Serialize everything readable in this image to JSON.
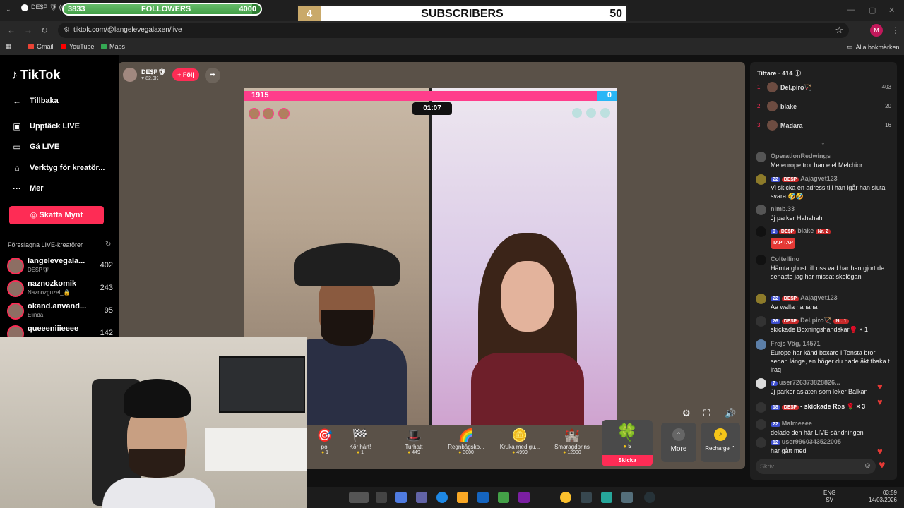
{
  "browser": {
    "tab_title": "DE$P 🛡 (@l",
    "url": "tiktok.com/@langelevegalaxen/live",
    "profile_initial": "M",
    "bookmarks": [
      "Gmail",
      "YouTube",
      "Maps"
    ],
    "all_bookmarks": "Alla bokmärken"
  },
  "overlay": {
    "followers_label": "FOLLOWERS",
    "followers_current": "3833",
    "followers_goal": "4000",
    "followers_progress": 0.958,
    "subs_number": "4",
    "subs_label": "SUBSCRIBERS",
    "subs_count": "50"
  },
  "sidebar": {
    "logo": "TikTok",
    "back": "Tillbaka",
    "nav": [
      "Upptäck LIVE",
      "Gå LIVE",
      "Verktyg för kreatör...",
      "Mer"
    ],
    "coins_button": "Skaffa Mynt",
    "suggested_title": "Föreslagna LIVE-kreatörer",
    "creators": [
      {
        "name": "langelevegala...",
        "sub": "DE$P🛡",
        "count": "402"
      },
      {
        "name": "naznozkomik",
        "sub": "Naznozguzel_🔒",
        "count": "243"
      },
      {
        "name": "okand.anvand...",
        "sub": "Elinda",
        "count": "95"
      },
      {
        "name": "queeeniiieeee",
        "sub": "",
        "count": "142"
      }
    ]
  },
  "stream": {
    "host_name": "DE$P🛡",
    "host_likes": "82.9K",
    "follow_label": "+ Följ",
    "battle_left": "1915",
    "battle_right": "0",
    "timer": "01:07",
    "colors": {
      "left": "#ff3d8b",
      "right": "#29b6f6"
    }
  },
  "gifts": [
    {
      "name": "pol",
      "price": "1",
      "icon": "🎯"
    },
    {
      "name": "Kör hårt!",
      "price": "1",
      "icon": "🏁"
    },
    {
      "name": "Turhatt",
      "price": "449",
      "icon": "🎩"
    },
    {
      "name": "Regnbågsko...",
      "price": "3000",
      "icon": "🌈"
    },
    {
      "name": "Kruka med gu...",
      "price": "4999",
      "icon": "🪙"
    },
    {
      "name": "Smaragdprins",
      "price": "12000",
      "icon": "🏰"
    }
  ],
  "selected_gift": {
    "icon": "🍀",
    "price": "5",
    "send": "Skicka"
  },
  "more_label": "More",
  "recharge_label": "Recharge ⌃",
  "chat": {
    "viewers_title": "Tittare · 414 ⓘ",
    "top_viewers": [
      {
        "rank": "1",
        "name": "Del.piro🏹",
        "score": "403"
      },
      {
        "rank": "2",
        "name": "blake",
        "score": "20"
      },
      {
        "rank": "3",
        "name": "Madara",
        "score": "16"
      }
    ],
    "messages": [
      {
        "user": "OperationRedwings",
        "badges": [],
        "text": "Me europe tror han e el Melchior"
      },
      {
        "user": "Aajagvet123",
        "badges": [
          "22",
          "DE$P"
        ],
        "text": "Vi skicka en adress till han igår han sluta svara 🤣🤣"
      },
      {
        "user": "nlmb.33",
        "badges": [],
        "text": "Jj parker Hahahah"
      },
      {
        "user": "blake",
        "badges": [
          "9",
          "DE$P",
          "Nr. 2"
        ],
        "text": "TAP TAP"
      },
      {
        "user": "Coltellino",
        "badges": [],
        "text": "Hämta ghost till oss vad har han gjort de senaste jag har missat skelögan"
      },
      {
        "user": "Aajagvet123",
        "badges": [
          "22",
          "DE$P"
        ],
        "text": "Aa walla hahaha"
      },
      {
        "user": "Del.piro🏹",
        "badges": [
          "26",
          "DE$P",
          "Nr. 1"
        ],
        "text": "skickade Boxningshandskar🥊 × 1"
      },
      {
        "user": "Frejs Väg, 14571",
        "badges": [],
        "text": "Europe har känd boxare i Tensta bror sedan länge, en höger du hade åkt tbaka t iraq"
      },
      {
        "user": "user726373828826...",
        "badges": [
          "7"
        ],
        "text": "Jj parker asiaten som leker Balkan"
      },
      {
        "user": "",
        "badges": [
          "18",
          "DE$P"
        ],
        "text": "- skickade Ros 🌹 × 3"
      },
      {
        "user": "Malmeeee",
        "badges": [
          "22"
        ],
        "text": "delade den här LIVE-sändningen"
      },
      {
        "user": "user9960343522005",
        "badges": [
          "12"
        ],
        "text": "har gått med"
      }
    ],
    "input_placeholder": "Skriv ..."
  },
  "taskbar": {
    "lang": "ENG",
    "lang_sub": "SV",
    "time": "03:59",
    "date": "14/03/2026"
  }
}
